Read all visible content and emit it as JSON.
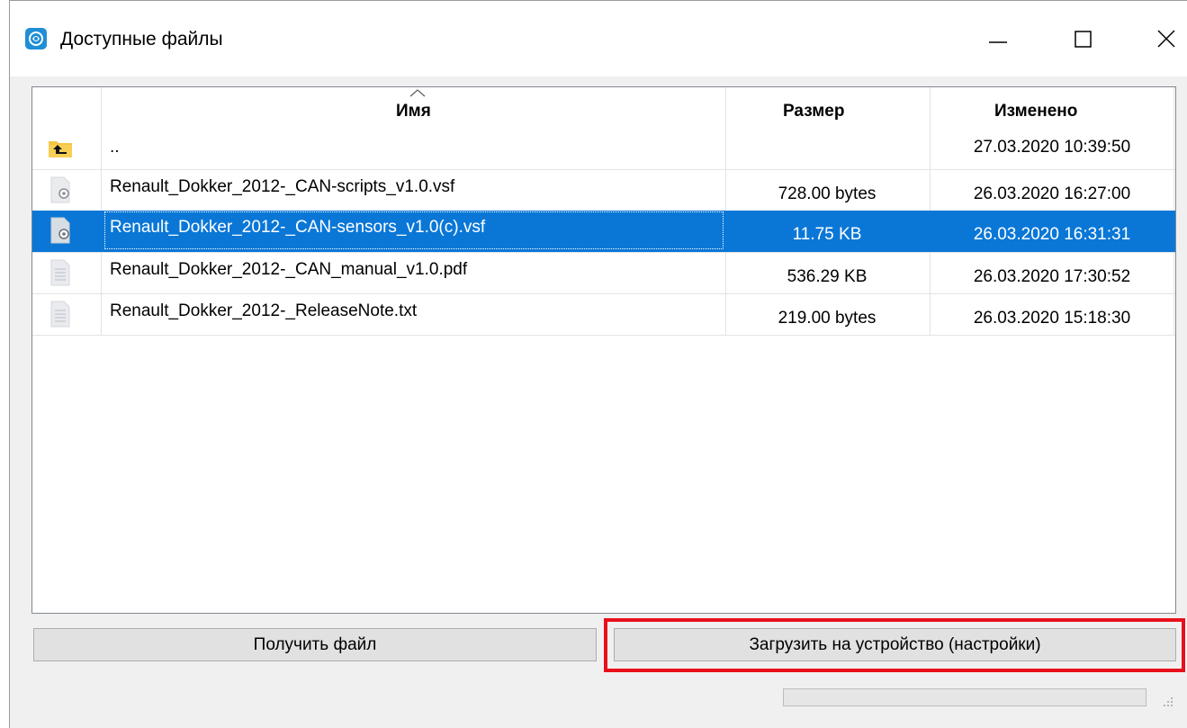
{
  "window": {
    "title": "Доступные файлы",
    "app_icon": "app-logo-icon",
    "controls": [
      "minimize-icon",
      "maximize-icon",
      "close-icon"
    ]
  },
  "file_list": {
    "columns": {
      "name": "Имя",
      "size": "Размер",
      "modified": "Изменено"
    },
    "sort_column": "name",
    "rows": [
      {
        "icon": "parent-folder-icon",
        "name": "..",
        "size": "",
        "modified": "27.03.2020 10:39:50",
        "selected": false
      },
      {
        "icon": "settings-file-icon",
        "name": "Renault_Dokker_2012-_CAN-scripts_v1.0.vsf",
        "size": "728.00 bytes",
        "modified": "26.03.2020 16:27:00",
        "selected": false
      },
      {
        "icon": "settings-file-icon",
        "name": "Renault_Dokker_2012-_CAN-sensors_v1.0(c).vsf",
        "size": "11.75 KB",
        "modified": "26.03.2020 16:31:31",
        "selected": true
      },
      {
        "icon": "document-icon",
        "name": "Renault_Dokker_2012-_CAN_manual_v1.0.pdf",
        "size": "536.29 KB",
        "modified": "26.03.2020 17:30:52",
        "selected": false
      },
      {
        "icon": "document-icon",
        "name": "Renault_Dokker_2012-_ReleaseNote.txt",
        "size": "219.00 bytes",
        "modified": "26.03.2020 15:18:30",
        "selected": false
      }
    ]
  },
  "buttons": {
    "get_file": "Получить файл",
    "upload_to_device": "Загрузить на устройство (настройки)"
  },
  "colors": {
    "selection": "#0a77d7",
    "highlight": "#e8101c"
  },
  "progress": 0
}
